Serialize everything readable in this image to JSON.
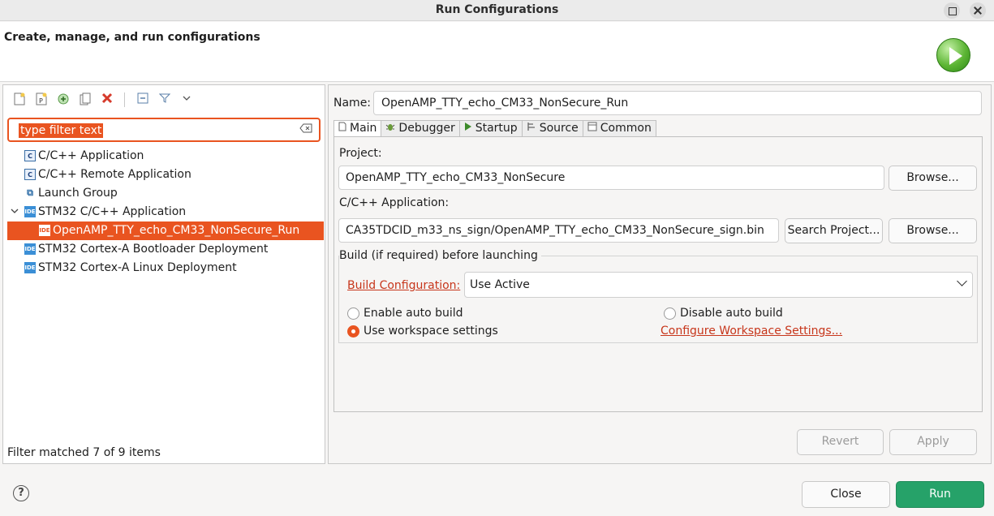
{
  "window": {
    "title": "Run Configurations"
  },
  "header": {
    "subtitle": "Create, manage, and run configurations"
  },
  "left": {
    "filter": {
      "selected_text": "type filter text"
    },
    "tree": [
      {
        "label": "C/C++ Application",
        "icon": "c-app-icon"
      },
      {
        "label": "C/C++ Remote Application",
        "icon": "c-app-icon"
      },
      {
        "label": "Launch Group",
        "icon": "launch-group-icon"
      },
      {
        "label": "STM32 C/C++ Application",
        "icon": "ide-icon",
        "expanded": true
      },
      {
        "label": "OpenAMP_TTY_echo_CM33_NonSecure_Run",
        "icon": "ide-icon",
        "selected": true
      },
      {
        "label": "STM32 Cortex-A Bootloader Deployment",
        "icon": "ide-icon"
      },
      {
        "label": "STM32 Cortex-A Linux Deployment",
        "icon": "ide-icon"
      }
    ],
    "status": "Filter matched 7 of 9 items"
  },
  "right": {
    "name_label": "Name:",
    "name_value": "OpenAMP_TTY_echo_CM33_NonSecure_Run",
    "tabs": [
      "Main",
      "Debugger",
      "Startup",
      "Source",
      "Common"
    ],
    "main": {
      "project_label": "Project:",
      "project_value": "OpenAMP_TTY_echo_CM33_NonSecure",
      "browse_label": "Browse...",
      "app_label": "C/C++ Application:",
      "app_value": "CA35TDCID_m33_ns_sign/OpenAMP_TTY_echo_CM33_NonSecure_sign.bin",
      "search_project_label": "Search Project...",
      "build_group_title": "Build (if required) before launching",
      "build_config_link": "Build Configuration:",
      "build_config_value": "Use Active",
      "enable_auto_build": "Enable auto build",
      "disable_auto_build": "Disable auto build",
      "use_workspace": "Use workspace settings",
      "configure_workspace_link": "Configure Workspace Settings..."
    },
    "revert_label": "Revert",
    "apply_label": "Apply"
  },
  "footer": {
    "close_label": "Close",
    "run_label": "Run"
  },
  "colors": {
    "accent": "#e95420",
    "run": "#26a269",
    "link": "#c7361b"
  }
}
